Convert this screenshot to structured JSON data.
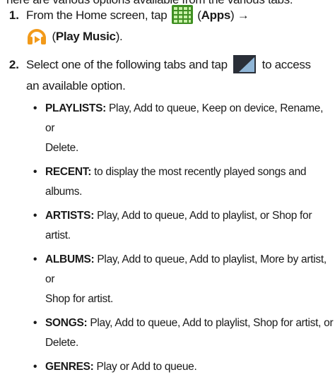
{
  "intro": "here are various options available from the various tabs:",
  "steps": [
    {
      "number": "1.",
      "pre": "From the Home screen, tap",
      "apps_paren_open": "(",
      "apps_label": "Apps",
      "apps_paren_close": ")",
      "arrow": "→",
      "music_paren_open": "(",
      "music_label": "Play Music",
      "music_paren_close": ")."
    },
    {
      "number": "2.",
      "line1_pre": "Select one of the following tabs and tap",
      "line1_post": "to access",
      "line2": "an available option."
    }
  ],
  "bullets": [
    {
      "label": "PLAYLISTS:",
      "text1": "Play, Add to queue, Keep on device, Rename, or",
      "text2": "Delete."
    },
    {
      "label": "RECENT:",
      "text1": "to display the most recently played songs and",
      "text2": "albums."
    },
    {
      "label": "ARTISTS:",
      "text1": "Play, Add to queue, Add to playlist, or Shop for artist.",
      "text2": ""
    },
    {
      "label": "ALBUMS:",
      "text1": "Play, Add to queue, Add to playlist, More by artist, or",
      "text2": "Shop for artist."
    },
    {
      "label": "SONGS:",
      "text1": "Play, Add to queue, Add to playlist, Shop for artist, or",
      "text2": "Delete."
    },
    {
      "label": "GENRES:",
      "text1": "Play or Add to queue.",
      "text2": ""
    }
  ],
  "bullet_glyph": "•",
  "icons": {
    "apps": "apps-grid-icon",
    "music": "play-music-headphones-icon",
    "menu": "menu-corner-icon"
  },
  "colors": {
    "apps_green": "#3f8f22",
    "music_orange": "#f29a1a",
    "menu_dark": "#2a2f38"
  }
}
